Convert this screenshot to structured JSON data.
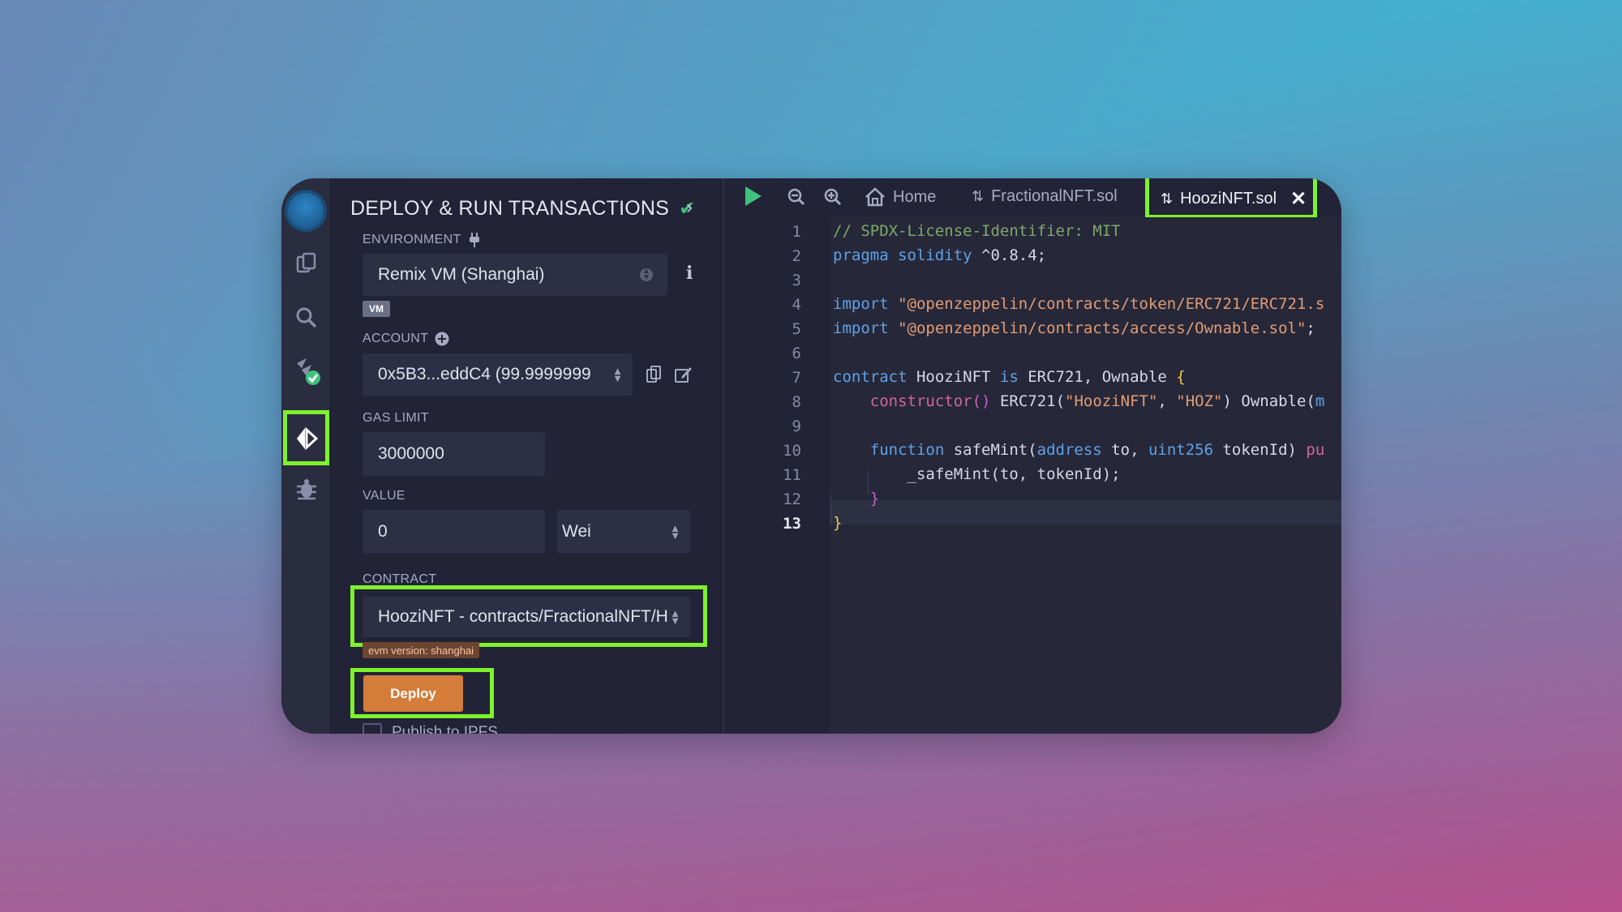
{
  "panel": {
    "title": "DEPLOY & RUN TRANSACTIONS",
    "environment_label": "ENVIRONMENT",
    "environment_value": "Remix VM (Shanghai)",
    "vm_badge": "VM",
    "account_label": "ACCOUNT",
    "account_value": "0x5B3...eddC4 (99.9999999",
    "gas_limit_label": "GAS LIMIT",
    "gas_limit_value": "3000000",
    "value_label": "VALUE",
    "value_amount": "0",
    "value_unit": "Wei",
    "contract_label": "CONTRACT",
    "contract_value": "HooziNFT - contracts/FractionalNFT/H",
    "evm_version": "evm version: shanghai",
    "deploy_label": "Deploy",
    "publish_label": "Publish to IPFS"
  },
  "tabs": {
    "home": "Home",
    "file1": "FractionalNFT.sol",
    "file2": "HooziNFT.sol"
  },
  "code": {
    "line_numbers": [
      "1",
      "2",
      "3",
      "4",
      "5",
      "6",
      "7",
      "8",
      "9",
      "10",
      "11",
      "12",
      "13"
    ],
    "current_line": "13"
  },
  "colors": {
    "highlight": "#7ef22c",
    "deploy": "#d47c3a",
    "check": "#3fc27d"
  },
  "icons": [
    "remix-logo-icon",
    "file-explorer-icon",
    "search-icon",
    "compiler-icon",
    "deploy-icon",
    "debugger-icon",
    "plug-icon",
    "info-icon",
    "plus-circle-icon",
    "copy-icon",
    "edit-icon",
    "run-icon",
    "zoom-out-icon",
    "zoom-in-icon",
    "home-icon",
    "file-sync-icon",
    "close-icon"
  ]
}
